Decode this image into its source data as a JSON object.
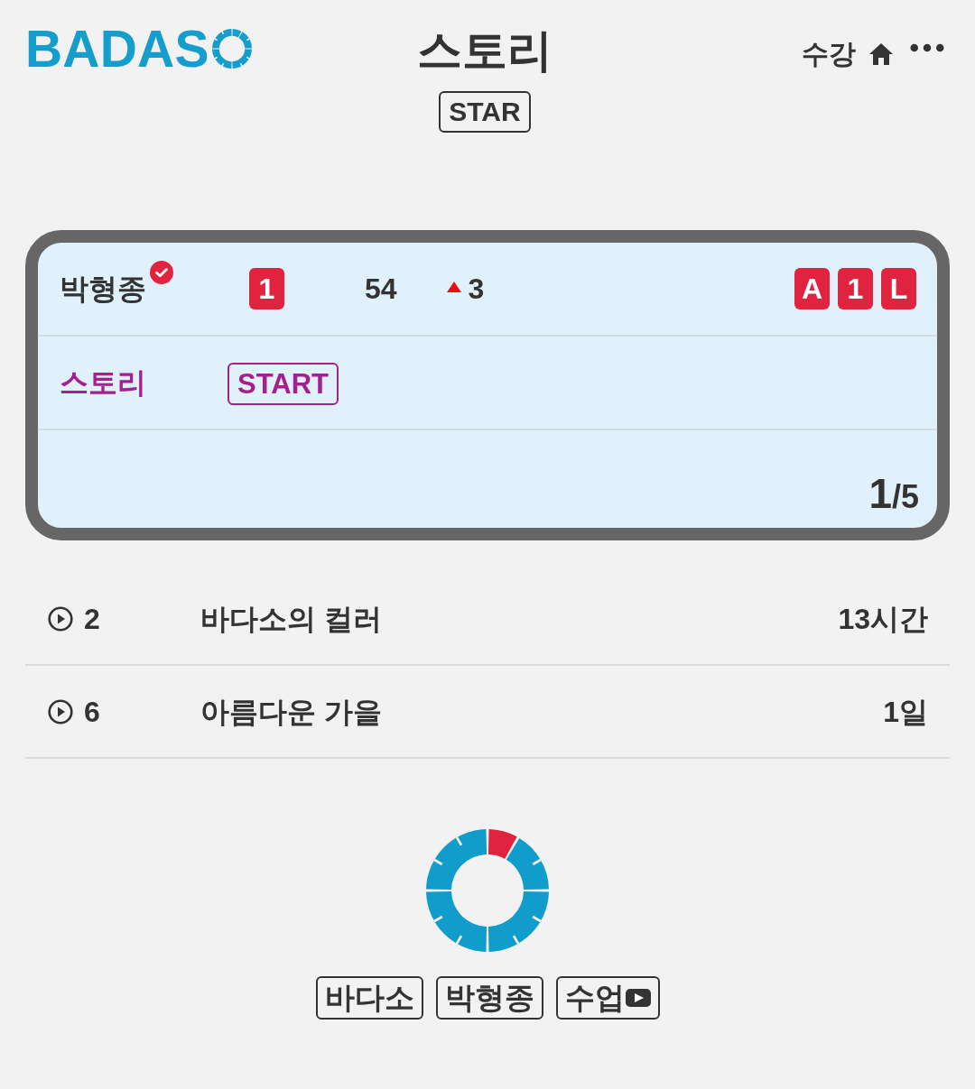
{
  "header": {
    "logo": "BADAS",
    "title": "스토리",
    "badge": "STAR",
    "link": "수강"
  },
  "card": {
    "name": "박형종",
    "verified": true,
    "rank": "1",
    "score": "54",
    "change": {
      "rising": true,
      "value": "3"
    },
    "tags": [
      {
        "label": "A"
      },
      {
        "label": "1"
      },
      {
        "label": "L"
      }
    ],
    "category": "스토리",
    "status": "START",
    "current": "1",
    "total": "/5"
  },
  "list": [
    {
      "number": "2",
      "title": "바다소의 컬러",
      "time": "13시간"
    },
    {
      "number": "6",
      "title": "아름다운 가을",
      "time": "1일"
    }
  ],
  "footer": {
    "buttons": [
      {
        "label": "바다소",
        "kind": "text"
      },
      {
        "label": "박형종",
        "kind": "text"
      },
      {
        "label": "수업",
        "kind": "video"
      }
    ]
  }
}
